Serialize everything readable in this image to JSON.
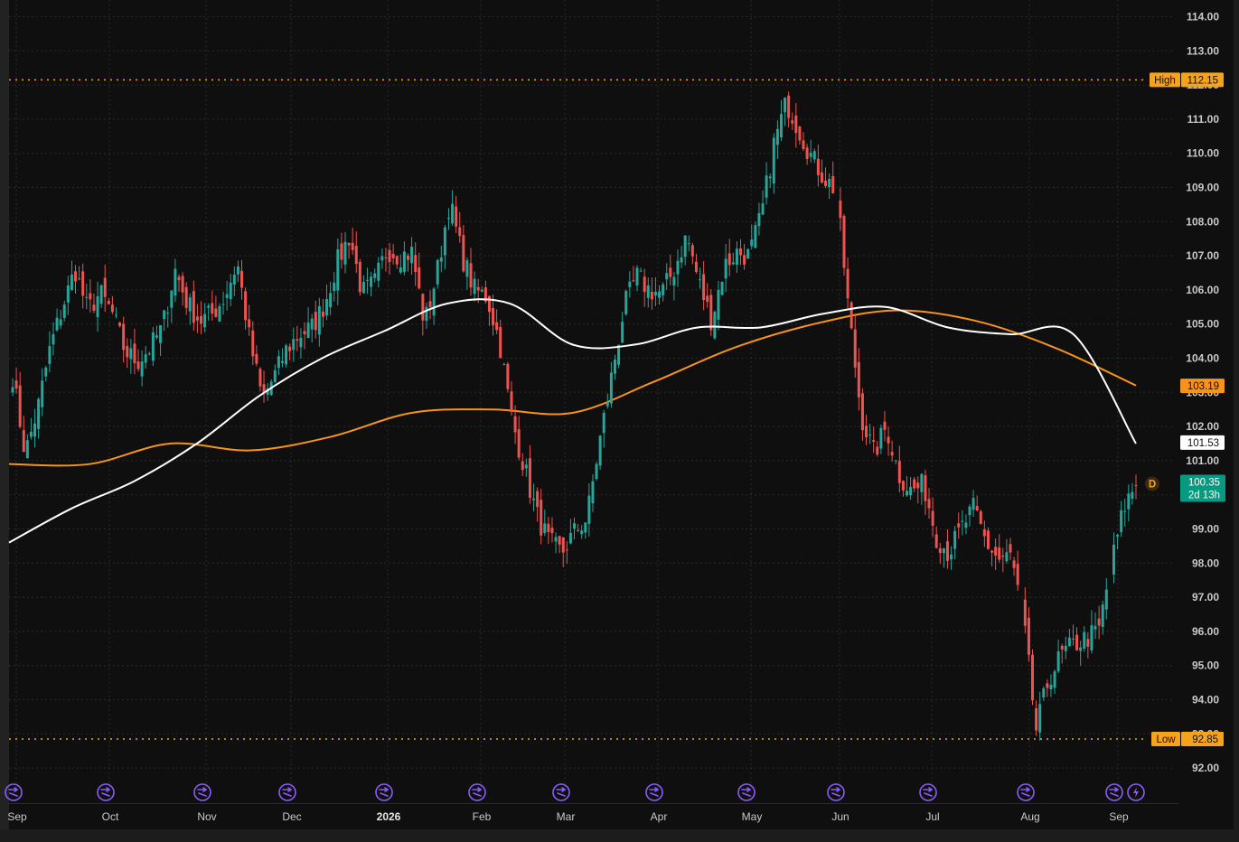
{
  "chart_data": {
    "type": "candlestick",
    "instrument_tags": {
      "high": {
        "label": "High",
        "value": "112.15"
      },
      "low": {
        "label": "Low",
        "value": "92.85"
      },
      "ma_orange_value": "103.19",
      "ma_white_value": "101.53",
      "last_price": "100.35",
      "countdown": "2d 13h",
      "dividend_marker": "D"
    },
    "y_axis": {
      "range": [
        91.4,
        114.4
      ],
      "ticks": [
        "114.00",
        "113.00",
        "112.00",
        "111.00",
        "110.00",
        "109.00",
        "108.00",
        "107.00",
        "106.00",
        "105.00",
        "104.00",
        "103.00",
        "102.00",
        "101.00",
        "100.00",
        "99.00",
        "98.00",
        "97.00",
        "96.00",
        "95.00",
        "94.00",
        "93.00",
        "92.00"
      ]
    },
    "x_axis": {
      "ticks": [
        "Sep",
        "Oct",
        "Nov",
        "Dec",
        "2026",
        "Feb",
        "Mar",
        "Apr",
        "May",
        "Jun",
        "Jul",
        "Aug",
        "Sep"
      ],
      "bold_tick": "2026"
    },
    "close_path": [
      [
        "Sep",
        103.5
      ],
      [
        "Sep",
        101.2
      ],
      [
        "Sep",
        102.5
      ],
      [
        "Sep",
        104.3
      ],
      [
        "Sep",
        105.5
      ],
      [
        "Sep",
        106.6
      ],
      [
        "Sep",
        105.4
      ],
      [
        "Sep",
        105.9
      ],
      [
        "Sep",
        105.3
      ],
      [
        "Oct",
        104.2
      ],
      [
        "Oct",
        103.9
      ],
      [
        "Oct",
        104.3
      ],
      [
        "Oct",
        104.9
      ],
      [
        "Oct",
        106.6
      ],
      [
        "Oct",
        105.6
      ],
      [
        "Oct",
        105.1
      ],
      [
        "Oct",
        105.3
      ],
      [
        "Nov",
        105.8
      ],
      [
        "Nov",
        106.8
      ],
      [
        "Nov",
        104.5
      ],
      [
        "Nov",
        102.8
      ],
      [
        "Nov",
        103.5
      ],
      [
        "Nov",
        104.3
      ],
      [
        "Nov",
        104.7
      ],
      [
        "Nov",
        104.9
      ],
      [
        "Dec",
        105.6
      ],
      [
        "Dec",
        106.8
      ],
      [
        "Dec",
        107.6
      ],
      [
        "Dec",
        105.9
      ],
      [
        "Dec",
        106.2
      ],
      [
        "Dec",
        107.2
      ],
      [
        "Dec",
        107.0
      ],
      [
        "Dec",
        107.1
      ],
      [
        "2026",
        105.0
      ],
      [
        "2026",
        106.5
      ],
      [
        "2026",
        108.6
      ],
      [
        "2026",
        107.0
      ],
      [
        "2026",
        106.0
      ],
      [
        "2026",
        105.8
      ],
      [
        "Feb",
        104.5
      ],
      [
        "Feb",
        102.2
      ],
      [
        "Feb",
        100.8
      ],
      [
        "Feb",
        99.4
      ],
      [
        "Feb",
        98.6
      ],
      [
        "Feb",
        98.3
      ],
      [
        "Feb",
        98.9
      ],
      [
        "Mar",
        99.3
      ],
      [
        "Mar",
        101.5
      ],
      [
        "Mar",
        103.5
      ],
      [
        "Mar",
        105.5
      ],
      [
        "Mar",
        106.4
      ],
      [
        "Mar",
        106.0
      ],
      [
        "Mar",
        105.9
      ],
      [
        "Apr",
        106.6
      ],
      [
        "Apr",
        107.6
      ],
      [
        "Apr",
        106.2
      ],
      [
        "Apr",
        105.1
      ],
      [
        "Apr",
        106.7
      ],
      [
        "Apr",
        107.1
      ],
      [
        "Apr",
        107.0
      ],
      [
        "May",
        108.2
      ],
      [
        "May",
        110.3
      ],
      [
        "May",
        111.5
      ],
      [
        "May",
        110.7
      ],
      [
        "May",
        109.9
      ],
      [
        "May",
        109.3
      ],
      [
        "May",
        108.9
      ],
      [
        "Jun",
        105.3
      ],
      [
        "Jun",
        102.3
      ],
      [
        "Jun",
        101.2
      ],
      [
        "Jun",
        102.0
      ],
      [
        "Jun",
        100.6
      ],
      [
        "Jun",
        100.1
      ],
      [
        "Jun",
        100.3
      ],
      [
        "Jul",
        98.8
      ],
      [
        "Jul",
        98.3
      ],
      [
        "Jul",
        99.0
      ],
      [
        "Jul",
        99.6
      ],
      [
        "Jul",
        98.6
      ],
      [
        "Jul",
        98.1
      ],
      [
        "Jul",
        98.2
      ],
      [
        "Aug",
        96.3
      ],
      [
        "Aug",
        93.1
      ],
      [
        "Aug",
        94.6
      ],
      [
        "Aug",
        95.3
      ],
      [
        "Aug",
        95.6
      ],
      [
        "Aug",
        95.8
      ],
      [
        "Aug",
        96.0
      ],
      [
        "Sep",
        97.9
      ],
      [
        "Sep",
        99.6
      ],
      [
        "Sep",
        100.35
      ]
    ],
    "ma_white": [
      98.6,
      99.6,
      100.4,
      101.5,
      102.9,
      104.0,
      104.8,
      105.6,
      105.6,
      104.4,
      104.4,
      104.9,
      104.9,
      105.3,
      105.5,
      104.9,
      104.7,
      104.7,
      101.5
    ],
    "ma_orange": [
      100.9,
      100.9,
      101.5,
      101.3,
      101.7,
      102.4,
      102.5,
      102.4,
      103.3,
      104.3,
      105.0,
      105.4,
      105.1,
      104.3,
      103.2
    ],
    "colors": {
      "up": "#26a69a",
      "down": "#ef5350",
      "ma_white": "#ffffff",
      "ma_orange": "#f7931a",
      "high_low_line": "#f7a21b",
      "last_price_bg": "#089981",
      "event_icon": "#8b5cf6",
      "grid": "#2a2a2a"
    },
    "event_icons": [
      "dividend-icon",
      "dividend-icon",
      "dividend-icon",
      "dividend-icon",
      "dividend-icon",
      "dividend-icon",
      "dividend-icon",
      "dividend-icon",
      "dividend-icon",
      "dividend-icon",
      "dividend-icon",
      "dividend-icon",
      "dividend-icon",
      "lightning-icon"
    ]
  }
}
